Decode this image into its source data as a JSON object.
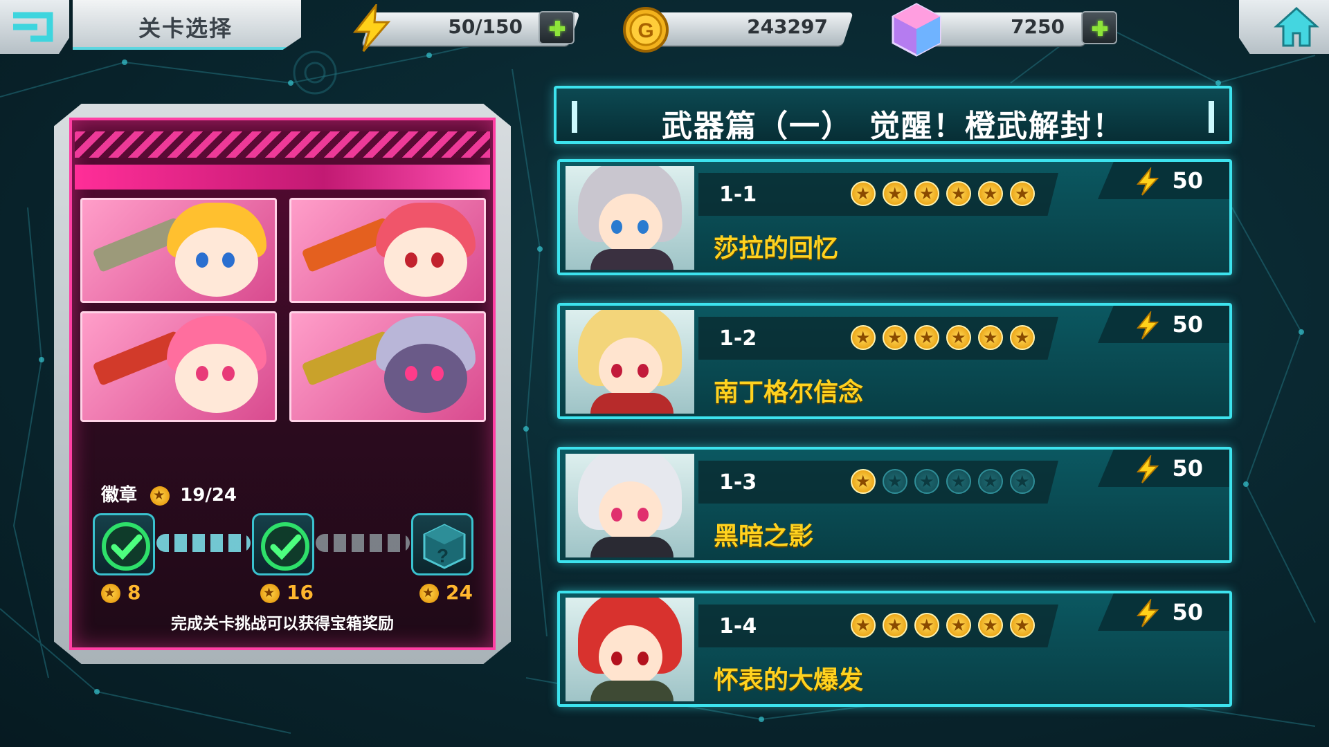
{
  "header": {
    "title": "关卡选择",
    "energy": {
      "value": "50/150",
      "icon": "lightning-icon"
    },
    "gold": {
      "value": "243297",
      "icon": "gold-coin-icon"
    },
    "gems": {
      "value": "7250",
      "icon": "crystal-icon"
    }
  },
  "reward_panel": {
    "badge_label": "徽章",
    "badge_progress": "19/24",
    "milestones": [
      {
        "stars": "8",
        "claimed": true
      },
      {
        "stars": "16",
        "claimed": true
      },
      {
        "stars": "24",
        "claimed": false
      }
    ],
    "hint": "完成关卡挑战可以获得宝箱奖励"
  },
  "chapter": {
    "title": "武器篇（一）　觉醒！橙武解封！"
  },
  "stages": [
    {
      "code": "1-1",
      "name": "莎拉的回忆",
      "stars": 6,
      "max_stars": 6,
      "cost": "50"
    },
    {
      "code": "1-2",
      "name": "南丁格尔信念",
      "stars": 6,
      "max_stars": 6,
      "cost": "50"
    },
    {
      "code": "1-3",
      "name": "黑暗之影",
      "stars": 1,
      "max_stars": 6,
      "cost": "50"
    },
    {
      "code": "1-4",
      "name": "怀表的大爆发",
      "stars": 6,
      "max_stars": 6,
      "cost": "50"
    }
  ],
  "colors": {
    "accent": "#3de3ee",
    "pink": "#ff3fa4",
    "gold_text": "#ffd21f",
    "energy_plus": "#8ee53a"
  }
}
